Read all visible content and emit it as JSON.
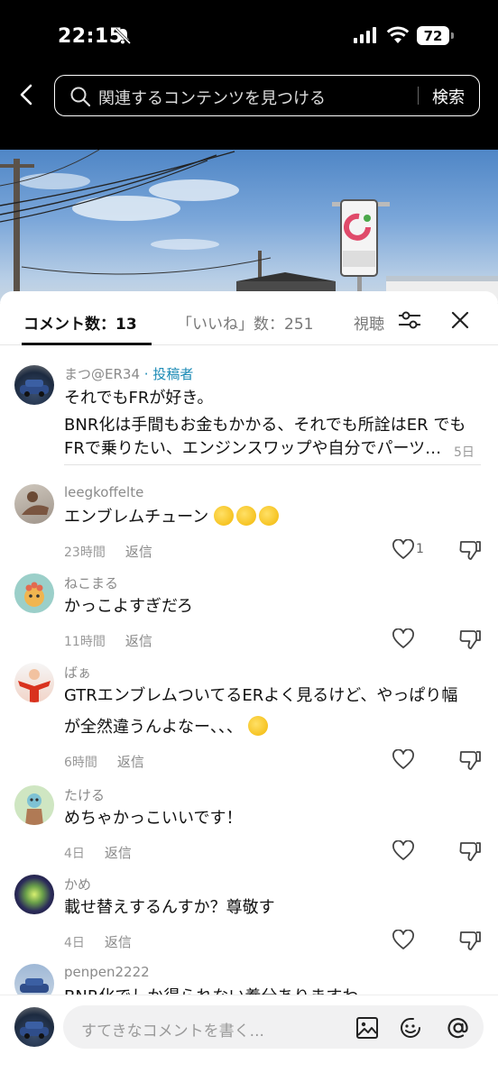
{
  "status_bar": {
    "time": "22:15",
    "battery": "72"
  },
  "search": {
    "placeholder": "関連するコンテンツを見つける",
    "button": "検索"
  },
  "tabs": {
    "comments": "コメント数：13",
    "likes": "「いいね」数：251",
    "views": "視聴"
  },
  "comments": [
    {
      "name": "まつ@ER34",
      "author_tag": "· 投稿者",
      "line1": "それでもFRが好き。",
      "line2": "BNR化は手間もお金もかかる、それでも所詮はER でも",
      "line3": "FRで乗りたい、エンジンスワップや自分でパーツ…",
      "date": "5日"
    },
    {
      "name": "leegkoffelte",
      "text": "エンブレムチューン",
      "time": "23時間",
      "reply": "返信",
      "likes": "1"
    },
    {
      "name": "ねこまる",
      "text": "かっこよすぎだろ",
      "time": "11時間",
      "reply": "返信"
    },
    {
      "name": "ばぁ",
      "line1": "GTRエンブレムついてるERよく見るけど、やっぱり幅",
      "line2": "が全然違うんよなー、、、",
      "time": "6時間",
      "reply": "返信"
    },
    {
      "name": "たける",
      "text": "めちゃかっこいいです！",
      "time": "4日",
      "reply": "返信"
    },
    {
      "name": "かめ",
      "text": "載せ替えするんすか？尊敬す",
      "time": "4日",
      "reply": "返信"
    },
    {
      "name": "penpen2222",
      "text": "BNR化でしか得られない養分ありますわ"
    }
  ],
  "input": {
    "placeholder": "すてきなコメントを書く..."
  },
  "icons": [
    "back-arrow-icon",
    "search-icon",
    "filter-icon",
    "close-icon",
    "heart-icon",
    "dislike-icon",
    "image-icon",
    "emoji-icon",
    "at-icon",
    "bell-off-icon",
    "wifi-icon"
  ]
}
